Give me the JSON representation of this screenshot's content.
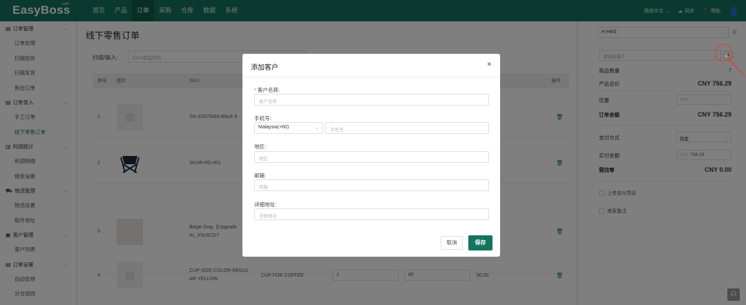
{
  "app": {
    "logo": "EasyBoss",
    "logo_suffix": ".com"
  },
  "topnav": {
    "items": [
      "首页",
      "产品",
      "订单",
      "采购",
      "仓库",
      "数据",
      "系统"
    ],
    "active": "订单",
    "lang": "简体中文",
    "sync": "同步",
    "help": "帮助"
  },
  "sidebar": {
    "groups": [
      {
        "label": "订单管理",
        "items": [
          "订单处理",
          "扫描验货",
          "扫描发货",
          "售后订单"
        ]
      },
      {
        "label": "订单录入",
        "items": [
          "手工订单",
          "线下零售订单"
        ]
      },
      {
        "label": "利润统计",
        "items": [
          "利润明细",
          "佣金设置"
        ]
      },
      {
        "label": "物流管理",
        "items": [
          "物流设置",
          "取件地址"
        ]
      },
      {
        "label": "客户管理",
        "items": [
          "客户列表"
        ]
      },
      {
        "label": "订单设置",
        "items": [
          "自动安排",
          "分仓规则"
        ]
      }
    ],
    "active_item": "线下零售订单"
  },
  "main": {
    "title": "线下零售订单",
    "scan_label": "扫描/输入:",
    "scan_placeholder": "SKU/商品代码",
    "columns": {
      "idx": "序号",
      "img": "图片",
      "sku": "SKU",
      "op": "操作"
    },
    "rows": [
      {
        "idx": "1",
        "sku": "Sts-32975933-Black-9",
        "name": "",
        "qty": "",
        "price": "",
        "total": ""
      },
      {
        "idx": "2",
        "sku": "SKUR-HD-001",
        "name": "",
        "qty": "",
        "price": "",
        "total": ""
      },
      {
        "idx": "3",
        "sku": "Beige Gray【Upgrade",
        "sku2": "41_X5z3CZr7",
        "name": "",
        "qty": "",
        "price": "",
        "total": ""
      },
      {
        "idx": "4",
        "sku": "CUP-SIZE-COLOR-REGUL",
        "sku2": "AR-YELLOW",
        "name": "CUP FOR COFFEE",
        "qty": "1",
        "price": "80",
        "total": "80.00"
      }
    ]
  },
  "right_panel": {
    "store_select": "H HAS",
    "customer_placeholder": "请选择客户",
    "product_qty_label": "商品数量",
    "product_qty": "7",
    "product_total_label": "产品总价",
    "product_total": "CNY 756.29",
    "discount_label": "优惠",
    "discount_placeholder": "CNY",
    "order_amount_label": "订单金额",
    "order_amount": "CNY 756.29",
    "pay_method_label": "支付方式",
    "pay_method": "现金",
    "paid_label": "实付金额",
    "paid_prefix": "CNY",
    "paid_value": "756.29",
    "change_label": "需找零",
    "change_value": "CNY 0.00",
    "upload_voucher": "上传支付凭证",
    "merchant_note": "商家备注"
  },
  "modal": {
    "title": "添加客户",
    "name_label": "客户名称:",
    "name_placeholder": "客户名称",
    "phone_label": "手机号:",
    "country_code": "Malaysia(+60)",
    "phone_placeholder": "手机号",
    "region_label": "地区:",
    "region_placeholder": "地区",
    "email_label": "邮箱:",
    "email_placeholder": "邮箱",
    "address_label": "详细地址:",
    "address_placeholder": "详细地址",
    "cancel": "取消",
    "save": "保存"
  },
  "colors": {
    "brand": "#14745f",
    "highlight": "#e0402f"
  }
}
